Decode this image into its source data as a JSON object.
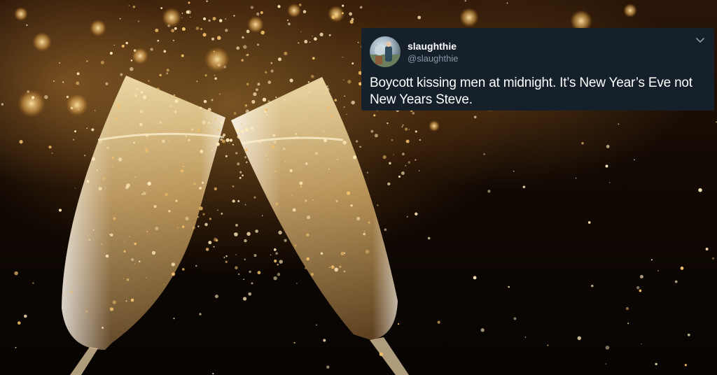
{
  "scene": {
    "subject": "two champagne flutes clinking with golden bokeh sparkles"
  },
  "tweet": {
    "display_name": "slaughthie",
    "handle": "@slaughthie",
    "text": "Boycott kissing men at midnight. It’s New Year’s Eve not New Years Steve.",
    "icons": {
      "menu": "chevron-down-icon",
      "avatar": "avatar-photo"
    },
    "colors": {
      "background": "#15202b",
      "text": "#ffffff",
      "secondary": "#8899a6"
    }
  }
}
